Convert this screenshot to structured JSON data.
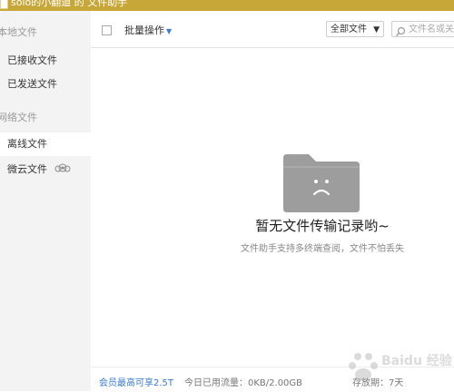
{
  "window": {
    "title": "solo的小翻道 的 文件助手"
  },
  "sidebar": {
    "groups": [
      {
        "label": "本地文件",
        "items": [
          {
            "label": "已接收文件"
          },
          {
            "label": "已发送文件"
          }
        ]
      },
      {
        "label": "网络文件",
        "items": [
          {
            "label": "离线文件",
            "active": true
          },
          {
            "label": "微云文件",
            "icon": "cloud-icon"
          }
        ]
      }
    ]
  },
  "toolbar": {
    "batch_label": "批量操作",
    "filter_value": "全部文件",
    "search_placeholder": "文件名或关"
  },
  "empty_state": {
    "title": "暂无文件传输记录哟~",
    "subtitle": "文件助手支持多终端查阅，文件不怕丢失",
    "icon": "sad-folder-icon"
  },
  "footer": {
    "vip_text": "会员最高可享2.5T",
    "traffic_text": "今日已用流量：0KB/2.00GB",
    "storage_text": "存放期：7天"
  },
  "watermark": {
    "text": "Baidu 经验"
  },
  "colors": {
    "titlebar": "#c8a739",
    "accent": "#3a7bd5",
    "sidebar_bg": "#f3f3f3"
  }
}
